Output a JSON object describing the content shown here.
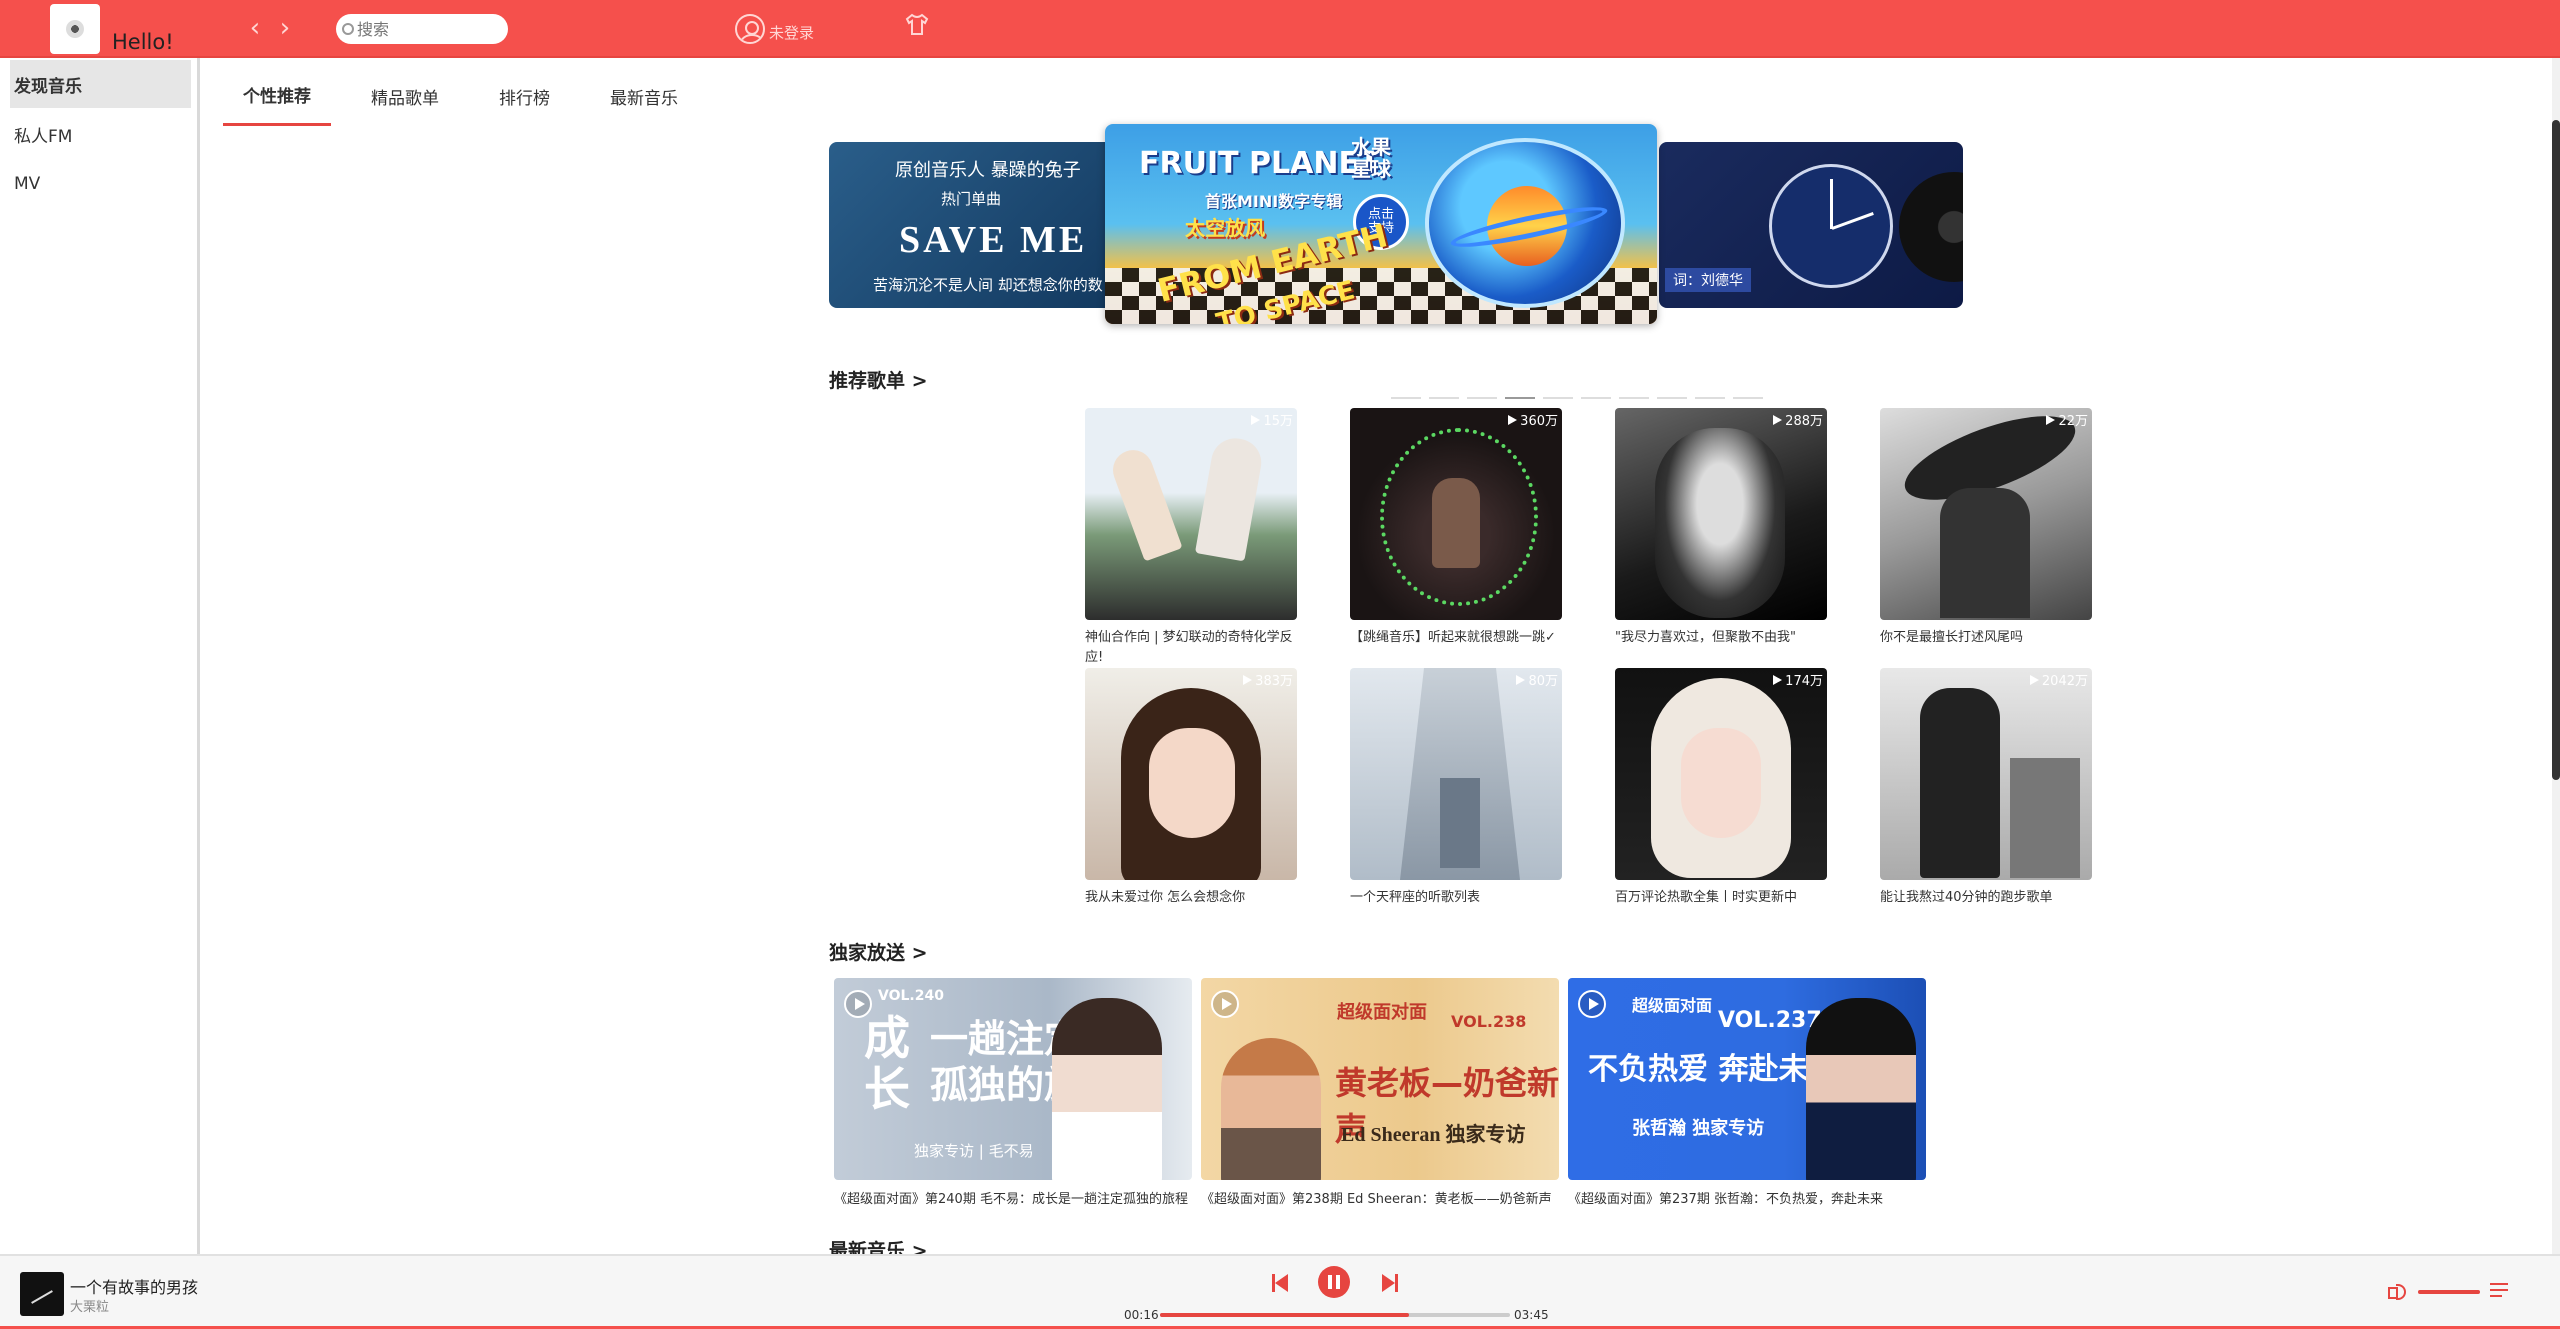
{
  "header": {
    "greeting": "Hello!",
    "search_placeholder": "搜索",
    "login_label": "未登录",
    "back_icon": "chevron-left-icon",
    "forward_icon": "chevron-right-icon",
    "skin_icon": "tshirt-icon",
    "accent_color": "#f5504c"
  },
  "sidebar": {
    "items": [
      {
        "label": "发现音乐",
        "active": true
      },
      {
        "label": "私人FM",
        "active": false
      },
      {
        "label": "MV",
        "active": false
      }
    ]
  },
  "tabs": [
    {
      "label": "个性推荐",
      "active": true
    },
    {
      "label": "精品歌单",
      "active": false
    },
    {
      "label": "排行榜",
      "active": false
    },
    {
      "label": "最新音乐",
      "active": false
    }
  ],
  "banner": {
    "left": {
      "line1": "原创音乐人 暴躁的兔子",
      "line2": "热门单曲",
      "line3": "SAVE ME",
      "line4": "苦海沉沦不是人间 却还想念你的数目"
    },
    "center": {
      "title": "FRUIT PLANET",
      "title_cn": "水果\n星球",
      "subtitle": "首张MINI数字专辑",
      "song": "太空放风",
      "slogan1": "FROM EARTH",
      "slogan2": "TO SPACE",
      "badge": "点击\n支持"
    },
    "right": {
      "caption": "词：刘德华"
    },
    "dot_count": 10,
    "active_dot": 3
  },
  "recommended": {
    "heading": "推荐歌单 >",
    "playlists": [
      {
        "count": "15万",
        "name": "神仙合作向 | 梦幻联动的奇特化学反应!"
      },
      {
        "count": "360万",
        "name": "【跳绳音乐】听起来就很想跳一跳✓"
      },
      {
        "count": "288万",
        "name": "\"我尽力喜欢过，但聚散不由我\""
      },
      {
        "count": "22万",
        "name": "你不是最擅长打述风尾吗"
      },
      {
        "count": "383万",
        "name": "我从未爱过你 怎么会想念你"
      },
      {
        "count": "80万",
        "name": "一个天秤座的听歌列表"
      },
      {
        "count": "174万",
        "name": "百万评论热歌全集丨时实更新中"
      },
      {
        "count": "2042万",
        "name": "能让我熬过40分钟的跑步歌单"
      }
    ]
  },
  "exclusive": {
    "heading": "独家放送 >",
    "items": [
      {
        "name": "《超级面对面》第240期 毛不易：成长是一趟注定孤独的旅程",
        "vol": "VOL.240",
        "big": "一趟注定\n孤独的旅程",
        "side": "成\n长",
        "sub": "独家专访 | 毛不易"
      },
      {
        "name": "《超级面对面》第238期 Ed Sheeran：黄老板——奶爸新声",
        "vol": "VOL.238",
        "big": "黄老板—奶爸新声",
        "side": "超级面对面",
        "sub": "Ed Sheeran 独家专访"
      },
      {
        "name": "《超级面对面》第237期 张哲瀚：不负热爱，奔赴未来",
        "vol": "VOL.237",
        "big": "不负热爱 奔赴未来",
        "side": "超级面对面",
        "sub": "张哲瀚 独家专访"
      }
    ]
  },
  "newest": {
    "heading": "最新音乐 >"
  },
  "player": {
    "title": "一个有故事的男孩",
    "artist": "大栗粒",
    "current": "00:16",
    "total": "03:45",
    "progress": 0.71,
    "volume": 1.0
  }
}
